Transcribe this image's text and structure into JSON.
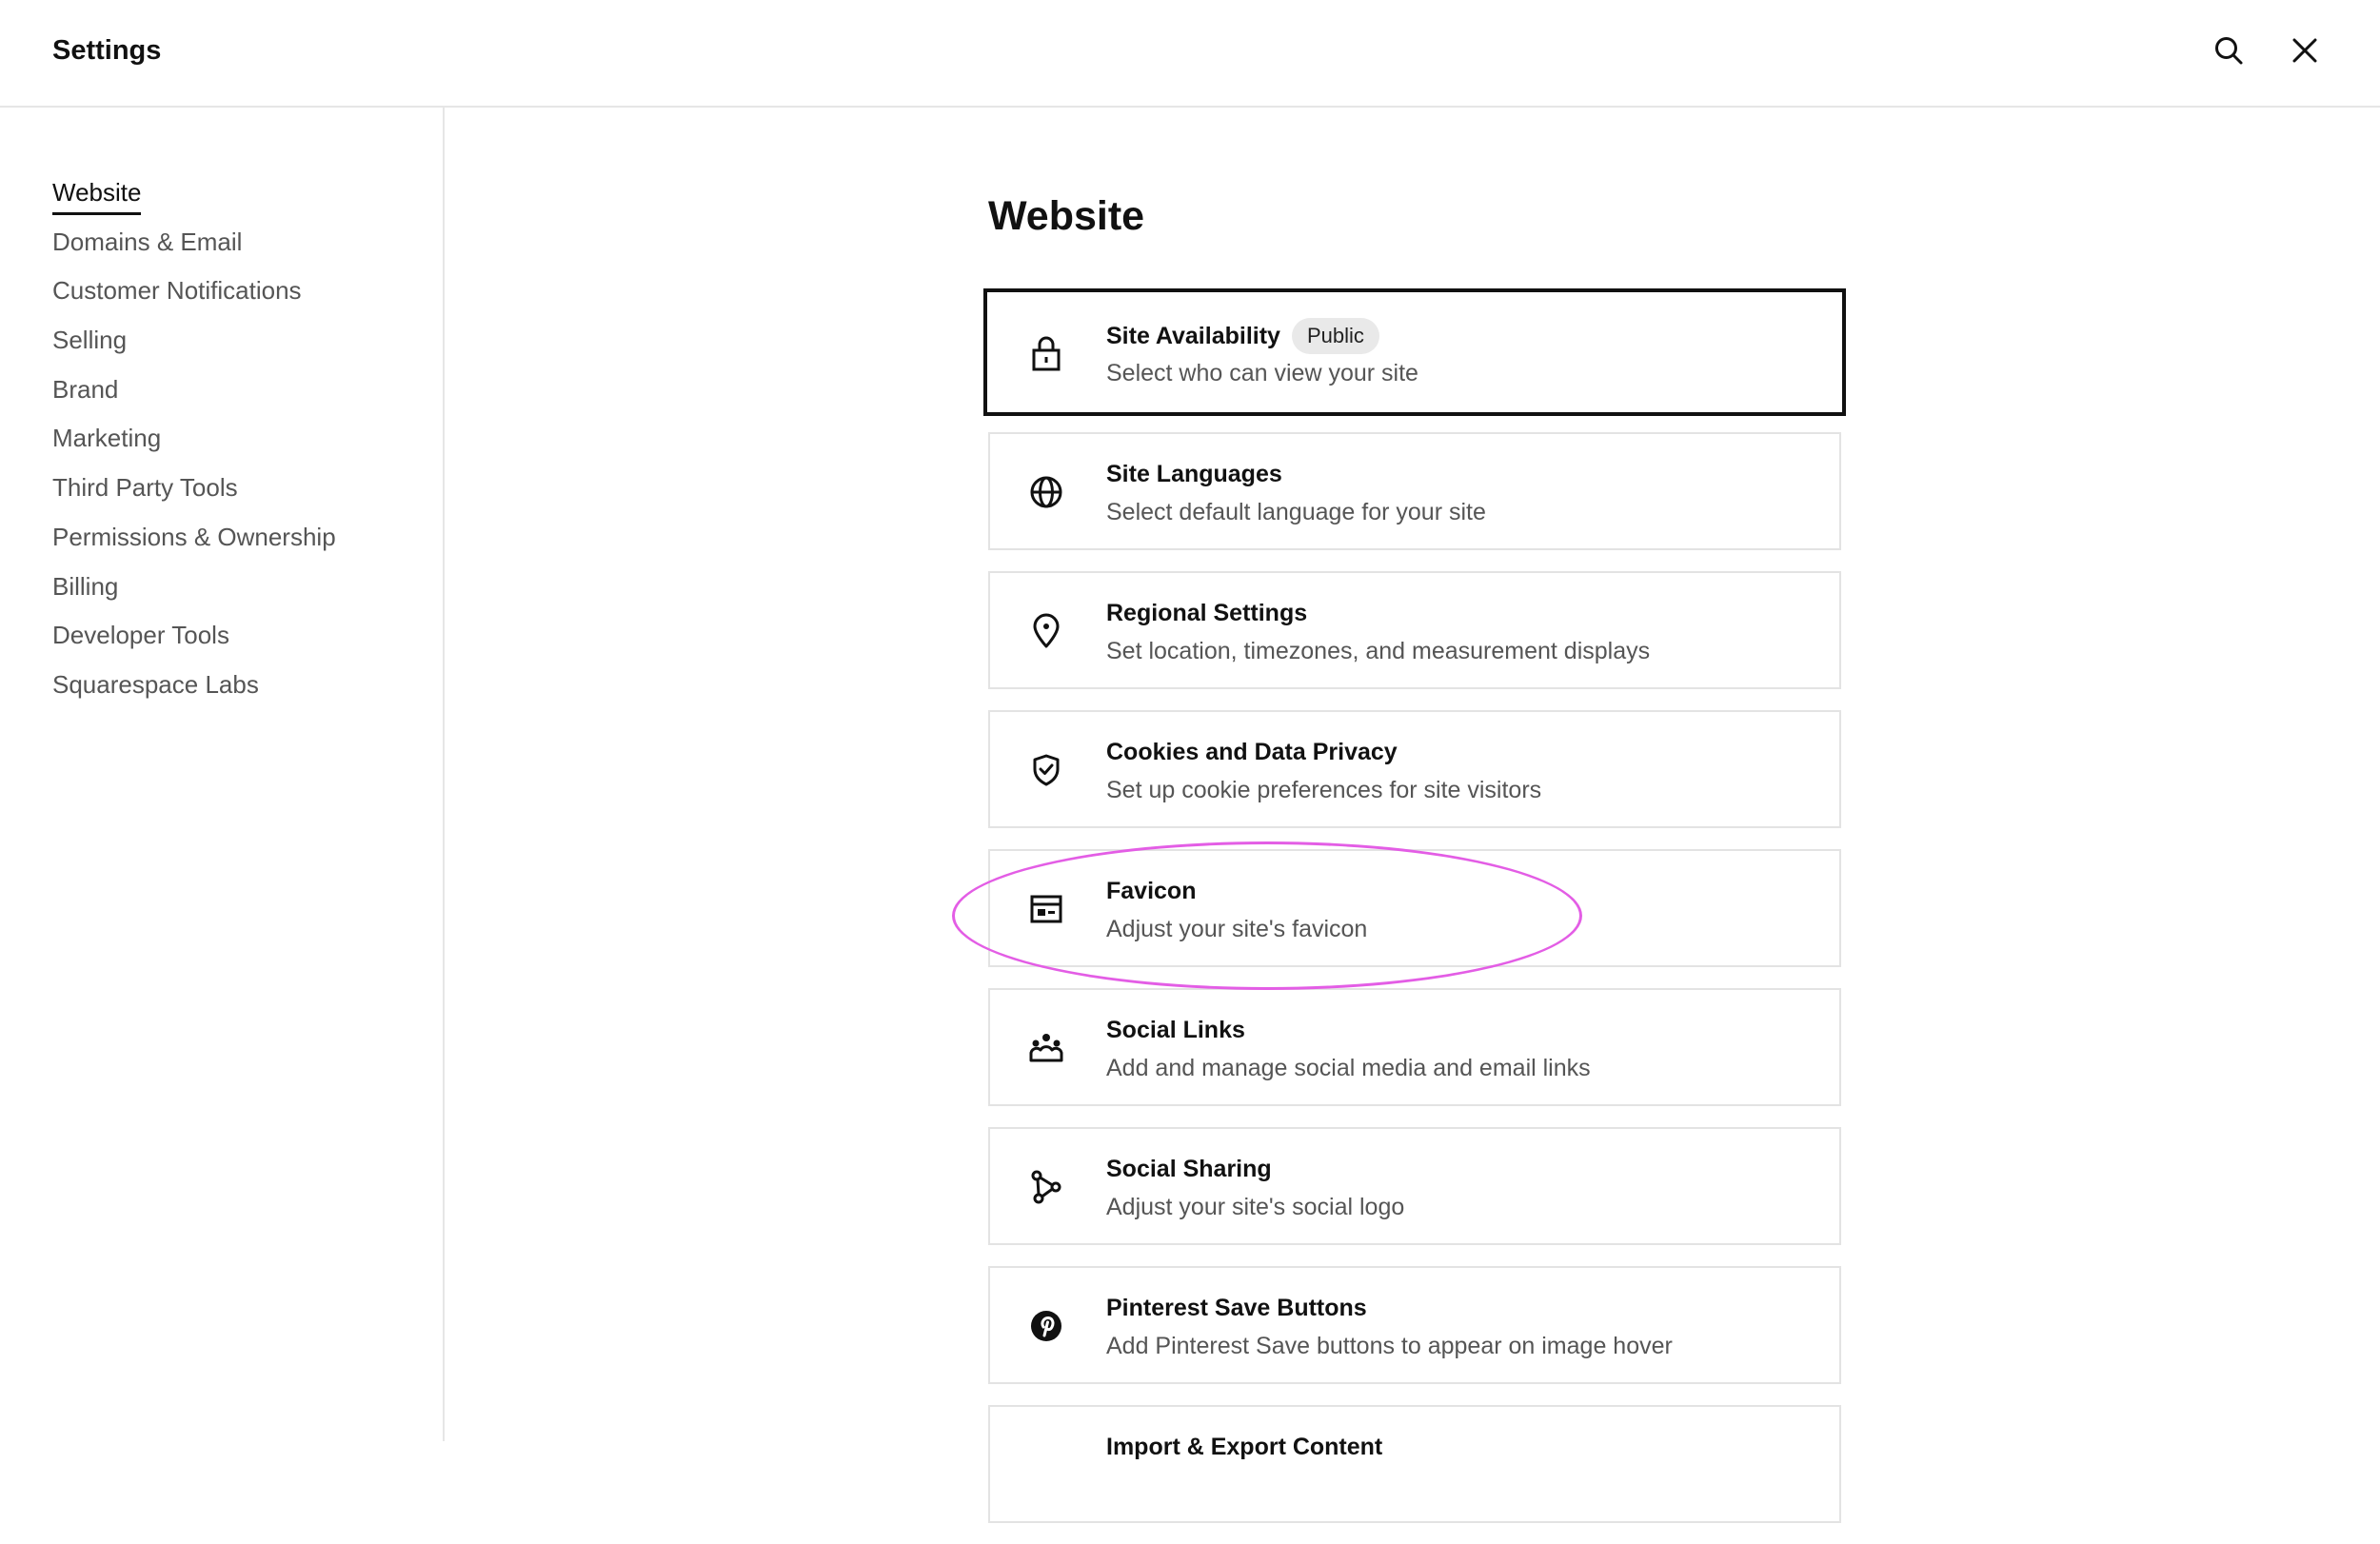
{
  "header": {
    "title": "Settings",
    "search_icon": "search-icon",
    "close_icon": "close-icon"
  },
  "sidebar": {
    "items": [
      {
        "label": "Website",
        "active": true
      },
      {
        "label": "Domains & Email",
        "active": false
      },
      {
        "label": "Customer Notifications",
        "active": false
      },
      {
        "label": "Selling",
        "active": false
      },
      {
        "label": "Brand",
        "active": false
      },
      {
        "label": "Marketing",
        "active": false
      },
      {
        "label": "Third Party Tools",
        "active": false
      },
      {
        "label": "Permissions & Ownership",
        "active": false
      },
      {
        "label": "Billing",
        "active": false
      },
      {
        "label": "Developer Tools",
        "active": false
      },
      {
        "label": "Squarespace Labs",
        "active": false
      }
    ]
  },
  "main": {
    "title": "Website",
    "cards": [
      {
        "title": "Site Availability",
        "badge": "Public",
        "description": "Select who can view your site",
        "icon": "lock-icon"
      },
      {
        "title": "Site Languages",
        "description": "Select default language for your site",
        "icon": "globe-icon"
      },
      {
        "title": "Regional Settings",
        "description": "Set location, timezones, and measurement displays",
        "icon": "location-pin-icon"
      },
      {
        "title": "Cookies and Data Privacy",
        "description": "Set up cookie preferences for site visitors",
        "icon": "shield-check-icon"
      },
      {
        "title": "Favicon",
        "description": "Adjust your site's favicon",
        "icon": "favicon-browser-icon"
      },
      {
        "title": "Social Links",
        "description": "Add and manage social media and email links",
        "icon": "social-people-icon"
      },
      {
        "title": "Social Sharing",
        "description": "Adjust your site's social logo",
        "icon": "share-nodes-icon"
      },
      {
        "title": "Pinterest Save Buttons",
        "description": "Add Pinterest Save buttons to appear on image hover",
        "icon": "pinterest-icon"
      },
      {
        "title": "Import & Export Content",
        "description": "",
        "icon": "import-export-icon"
      }
    ]
  },
  "colors": {
    "annotation": "#e35de5",
    "text_primary": "#111111",
    "text_secondary": "#555555",
    "border": "#e3e3e3"
  }
}
